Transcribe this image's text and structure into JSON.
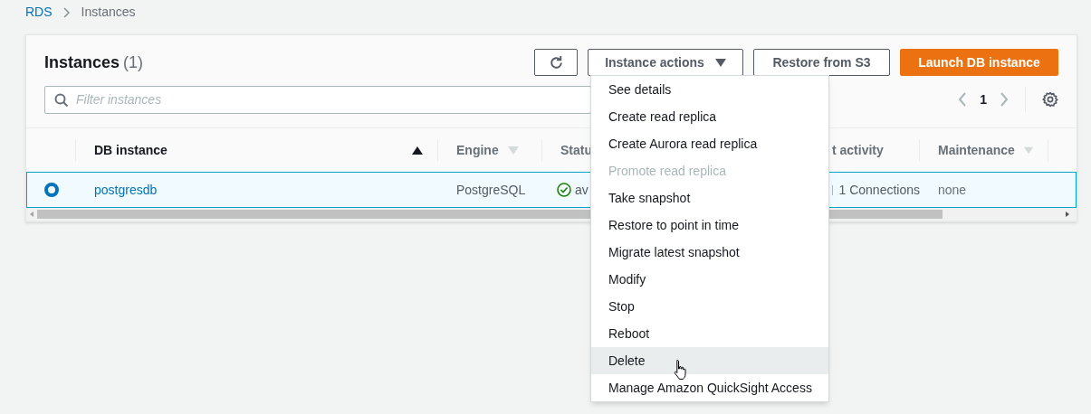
{
  "breadcrumb": [
    {
      "label": "RDS",
      "link": true
    },
    {
      "label": "Instances",
      "link": false
    }
  ],
  "panel": {
    "title": "Instances",
    "count": "(1)",
    "buttons": [
      {
        "kind": "refresh"
      },
      {
        "kind": "dropdown",
        "label": "Instance actions"
      },
      {
        "kind": "normal",
        "label": "Restore from S3"
      },
      {
        "kind": "primary",
        "label": "Launch DB instance"
      }
    ],
    "search": {
      "placeholder": "Filter instances"
    },
    "pagination": {
      "page": "1"
    },
    "table": {
      "columns": [
        {
          "label": "DB instance",
          "sortable": true,
          "sorted": true
        },
        {
          "label": "Engine",
          "sortable": true,
          "sorted": false
        },
        {
          "label": "Statu",
          "sortable": false,
          "sorted": false
        },
        {
          "label": "t activity",
          "sortable": false,
          "sorted": false
        },
        {
          "label": "Maintenance",
          "sortable": true,
          "sorted": false
        }
      ],
      "rows": [
        {
          "selected": true,
          "cells": [
            "postgresdb",
            "PostgreSQL",
            "av",
            "1 Connections",
            "none"
          ]
        }
      ]
    }
  },
  "menu": {
    "items": [
      {
        "label": "See details",
        "disabled": false,
        "highlighted": false
      },
      {
        "label": "Create read replica",
        "disabled": false,
        "highlighted": false
      },
      {
        "label": "Create Aurora read replica",
        "disabled": false,
        "highlighted": false
      },
      {
        "label": "Promote read replica",
        "disabled": true,
        "highlighted": false
      },
      {
        "label": "Take snapshot",
        "disabled": false,
        "highlighted": false
      },
      {
        "label": "Restore to point in time",
        "disabled": false,
        "highlighted": false
      },
      {
        "label": "Migrate latest snapshot",
        "disabled": false,
        "highlighted": false
      },
      {
        "label": "Modify",
        "disabled": false,
        "highlighted": false
      },
      {
        "label": "Stop",
        "disabled": false,
        "highlighted": false
      },
      {
        "label": "Reboot",
        "disabled": false,
        "highlighted": false
      },
      {
        "label": "Delete",
        "disabled": false,
        "highlighted": true
      },
      {
        "label": "Manage Amazon QuickSight Access",
        "disabled": false,
        "highlighted": false
      }
    ]
  }
}
